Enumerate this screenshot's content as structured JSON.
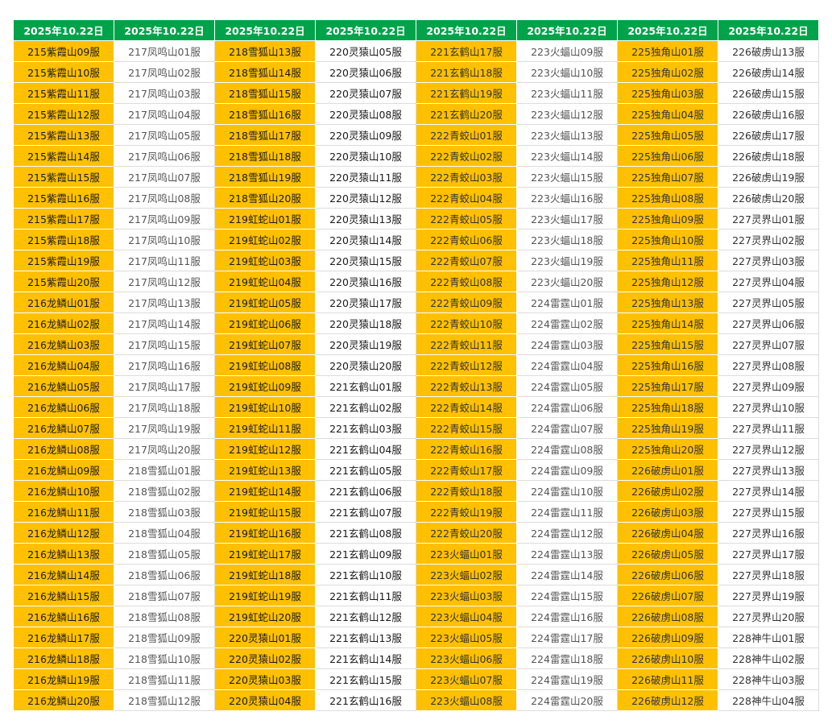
{
  "table": {
    "headers": [
      "2025年10.22日",
      "2025年10.22日",
      "2025年10.22日",
      "2025年10.22日",
      "2025年10.22日",
      "2025年10.22日",
      "2025年10.22日",
      "2025年10.22日"
    ],
    "columns": [
      {
        "highlight": true,
        "tone": "dark",
        "cells": [
          "215紫霞山09服",
          "215紫霞山10服",
          "215紫霞山11服",
          "215紫霞山12服",
          "215紫霞山13服",
          "215紫霞山14服",
          "215紫霞山15服",
          "215紫霞山16服",
          "215紫霞山17服",
          "215紫霞山18服",
          "215紫霞山19服",
          "215紫霞山20服",
          "216龙鳞山01服",
          "216龙鳞山02服",
          "216龙鳞山03服",
          "216龙鳞山04服",
          "216龙鳞山05服",
          "216龙鳞山06服",
          "216龙鳞山07服",
          "216龙鳞山08服",
          "216龙鳞山09服",
          "216龙鳞山10服",
          "216龙鳞山11服",
          "216龙鳞山12服",
          "216龙鳞山13服",
          "216龙鳞山14服",
          "216龙鳞山15服",
          "216龙鳞山16服",
          "216龙鳞山17服",
          "216龙鳞山18服",
          "216龙鳞山19服",
          "216龙鳞山20服"
        ]
      },
      {
        "highlight": false,
        "tone": "soft",
        "cells": [
          "217凤鸣山01服",
          "217凤鸣山02服",
          "217凤鸣山03服",
          "217凤鸣山04服",
          "217凤鸣山05服",
          "217凤鸣山06服",
          "217凤鸣山07服",
          "217凤鸣山08服",
          "217凤鸣山09服",
          "217凤鸣山10服",
          "217凤鸣山11服",
          "217凤鸣山12服",
          "217凤鸣山13服",
          "217凤鸣山14服",
          "217凤鸣山15服",
          "217凤鸣山16服",
          "217凤鸣山17服",
          "217凤鸣山18服",
          "217凤鸣山19服",
          "217凤鸣山20服",
          "218雪狐山01服",
          "218雪狐山02服",
          "218雪狐山03服",
          "218雪狐山04服",
          "218雪狐山05服",
          "218雪狐山06服",
          "218雪狐山07服",
          "218雪狐山08服",
          "218雪狐山09服",
          "218雪狐山10服",
          "218雪狐山11服",
          "218雪狐山12服"
        ]
      },
      {
        "highlight": true,
        "tone": "dark",
        "cells": [
          "218雪狐山13服",
          "218雪狐山14服",
          "218雪狐山15服",
          "218雪狐山16服",
          "218雪狐山17服",
          "218雪狐山18服",
          "218雪狐山19服",
          "218雪狐山20服",
          "219虹蛇山01服",
          "219虹蛇山02服",
          "219虹蛇山03服",
          "219虹蛇山04服",
          "219虹蛇山05服",
          "219虹蛇山06服",
          "219虹蛇山07服",
          "219虹蛇山08服",
          "219虹蛇山09服",
          "219虹蛇山10服",
          "219虹蛇山11服",
          "219虹蛇山12服",
          "219虹蛇山13服",
          "219虹蛇山14服",
          "219虹蛇山15服",
          "219虹蛇山16服",
          "219虹蛇山17服",
          "219虹蛇山18服",
          "219虹蛇山19服",
          "219虹蛇山20服",
          "220灵猿山01服",
          "220灵猿山02服",
          "220灵猿山03服",
          "220灵猿山04服"
        ]
      },
      {
        "highlight": false,
        "tone": "dark",
        "cells": [
          "220灵猿山05服",
          "220灵猿山06服",
          "220灵猿山07服",
          "220灵猿山08服",
          "220灵猿山09服",
          "220灵猿山10服",
          "220灵猿山11服",
          "220灵猿山12服",
          "220灵猿山13服",
          "220灵猿山14服",
          "220灵猿山15服",
          "220灵猿山16服",
          "220灵猿山17服",
          "220灵猿山18服",
          "220灵猿山19服",
          "220灵猿山20服",
          "221玄鹤山01服",
          "221玄鹤山02服",
          "221玄鹤山03服",
          "221玄鹤山04服",
          "221玄鹤山05服",
          "221玄鹤山06服",
          "221玄鹤山07服",
          "221玄鹤山08服",
          "221玄鹤山09服",
          "221玄鹤山10服",
          "221玄鹤山11服",
          "221玄鹤山12服",
          "221玄鹤山13服",
          "221玄鹤山14服",
          "221玄鹤山15服",
          "221玄鹤山16服"
        ]
      },
      {
        "highlight": true,
        "tone": "mid",
        "cells": [
          "221玄鹤山17服",
          "221玄鹤山18服",
          "221玄鹤山19服",
          "221玄鹤山20服",
          "222青蛟山01服",
          "222青蛟山02服",
          "222青蛟山03服",
          "222青蛟山04服",
          "222青蛟山05服",
          "222青蛟山06服",
          "222青蛟山07服",
          "222青蛟山08服",
          "222青蛟山09服",
          "222青蛟山10服",
          "222青蛟山11服",
          "222青蛟山12服",
          "222青蛟山13服",
          "222青蛟山14服",
          "222青蛟山15服",
          "222青蛟山16服",
          "222青蛟山17服",
          "222青蛟山18服",
          "222青蛟山19服",
          "222青蛟山20服",
          "223火蝠山01服",
          "223火蝠山02服",
          "223火蝠山03服",
          "223火蝠山04服",
          "223火蝠山05服",
          "223火蝠山06服",
          "223火蝠山07服",
          "223火蝠山08服"
        ]
      },
      {
        "highlight": false,
        "tone": "soft",
        "cells": [
          "223火蝠山09服",
          "223火蝠山10服",
          "223火蝠山11服",
          "223火蝠山12服",
          "223火蝠山13服",
          "223火蝠山14服",
          "223火蝠山15服",
          "223火蝠山16服",
          "223火蝠山17服",
          "223火蝠山18服",
          "223火蝠山19服",
          "223火蝠山20服",
          "224雷霆山01服",
          "224雷霆山02服",
          "224雷霆山03服",
          "224雷霆山04服",
          "224雷霆山05服",
          "224雷霆山06服",
          "224雷霆山07服",
          "224雷霆山08服",
          "224雷霆山09服",
          "224雷霆山10服",
          "224雷霆山11服",
          "224雷霆山12服",
          "224雷霆山13服",
          "224雷霆山14服",
          "224雷霆山15服",
          "224雷霆山16服",
          "224雷霆山17服",
          "224雷霆山18服",
          "224雷霆山19服",
          "224雷霆山20服"
        ]
      },
      {
        "highlight": true,
        "tone": "mid",
        "cells": [
          "225独角山01服",
          "225独角山02服",
          "225独角山03服",
          "225独角山04服",
          "225独角山05服",
          "225独角山06服",
          "225独角山07服",
          "225独角山08服",
          "225独角山09服",
          "225独角山10服",
          "225独角山11服",
          "225独角山12服",
          "225独角山13服",
          "225独角山14服",
          "225独角山15服",
          "225独角山16服",
          "225独角山17服",
          "225独角山18服",
          "225独角山19服",
          "225独角山20服",
          "226破虏山01服",
          "226破虏山02服",
          "226破虏山03服",
          "226破虏山04服",
          "226破虏山05服",
          "226破虏山06服",
          "226破虏山07服",
          "226破虏山08服",
          "226破虏山09服",
          "226破虏山10服",
          "226破虏山11服",
          "226破虏山12服"
        ]
      },
      {
        "highlight": false,
        "tone": "mid",
        "cells": [
          "226破虏山13服",
          "226破虏山14服",
          "226破虏山15服",
          "226破虏山16服",
          "226破虏山17服",
          "226破虏山18服",
          "226破虏山19服",
          "226破虏山20服",
          "227灵界山01服",
          "227灵界山02服",
          "227灵界山03服",
          "227灵界山04服",
          "227灵界山05服",
          "227灵界山06服",
          "227灵界山07服",
          "227灵界山08服",
          "227灵界山09服",
          "227灵界山10服",
          "227灵界山11服",
          "227灵界山12服",
          "227灵界山13服",
          "227灵界山14服",
          "227灵界山15服",
          "227灵界山16服",
          "227灵界山17服",
          "227灵界山18服",
          "227灵界山19服",
          "227灵界山20服",
          "228神牛山01服",
          "228神牛山02服",
          "228神牛山03服",
          "228神牛山04服"
        ]
      }
    ]
  },
  "colors": {
    "header_bg": "#00a24a",
    "header_text": "#ffffff",
    "highlight_bg": "#ffc000",
    "grid_line": "#dcdcdc"
  }
}
